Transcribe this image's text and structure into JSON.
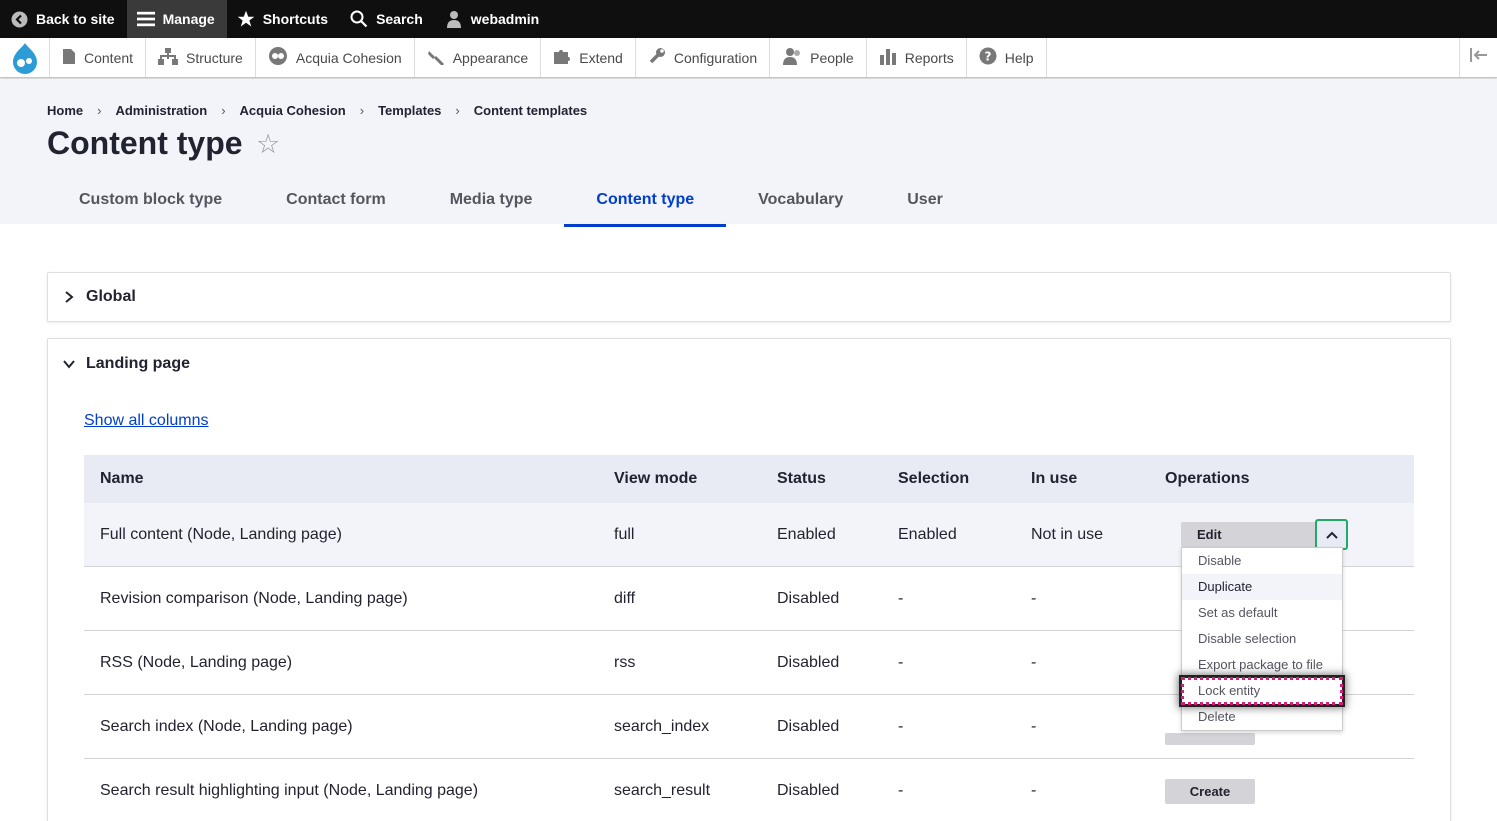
{
  "toolbar": {
    "back_to_site": "Back to site",
    "manage": "Manage",
    "shortcuts": "Shortcuts",
    "search": "Search",
    "user": "webadmin"
  },
  "tray": {
    "items": [
      "Content",
      "Structure",
      "Acquia Cohesion",
      "Appearance",
      "Extend",
      "Configuration",
      "People",
      "Reports",
      "Help"
    ]
  },
  "breadcrumb": [
    "Home",
    "Administration",
    "Acquia Cohesion",
    "Templates",
    "Content templates"
  ],
  "page_title": "Content type",
  "tabs": [
    "Custom block type",
    "Contact form",
    "Media type",
    "Content type",
    "Vocabulary",
    "User"
  ],
  "active_tab": "Content type",
  "panels": {
    "global": "Global",
    "landing": "Landing page"
  },
  "show_all_columns": "Show all columns",
  "table": {
    "headers": [
      "Name",
      "View mode",
      "Status",
      "Selection",
      "In use",
      "Operations"
    ],
    "rows": [
      {
        "name": "Full content (Node, Landing page)",
        "view": "full",
        "status": "Enabled",
        "selection": "Enabled",
        "in_use": "Not in use"
      },
      {
        "name": "Revision comparison (Node, Landing page)",
        "view": "diff",
        "status": "Disabled",
        "selection": "-",
        "in_use": "-"
      },
      {
        "name": "RSS (Node, Landing page)",
        "view": "rss",
        "status": "Disabled",
        "selection": "-",
        "in_use": "-"
      },
      {
        "name": "Search index (Node, Landing page)",
        "view": "search_index",
        "status": "Disabled",
        "selection": "-",
        "in_use": "-"
      },
      {
        "name": "Search result highlighting input (Node, Landing page)",
        "view": "search_result",
        "status": "Disabled",
        "selection": "-",
        "in_use": "-"
      }
    ],
    "create_label": "Create"
  },
  "dropdown": {
    "edit": "Edit",
    "items": [
      "Disable",
      "Duplicate",
      "Set as default",
      "Disable selection",
      "Export package to file",
      "Lock entity",
      "Delete"
    ]
  },
  "colors": {
    "active_tab": "#003ecc",
    "toggle_focus": "#26a769",
    "lock_focus": "#d31e7c"
  }
}
